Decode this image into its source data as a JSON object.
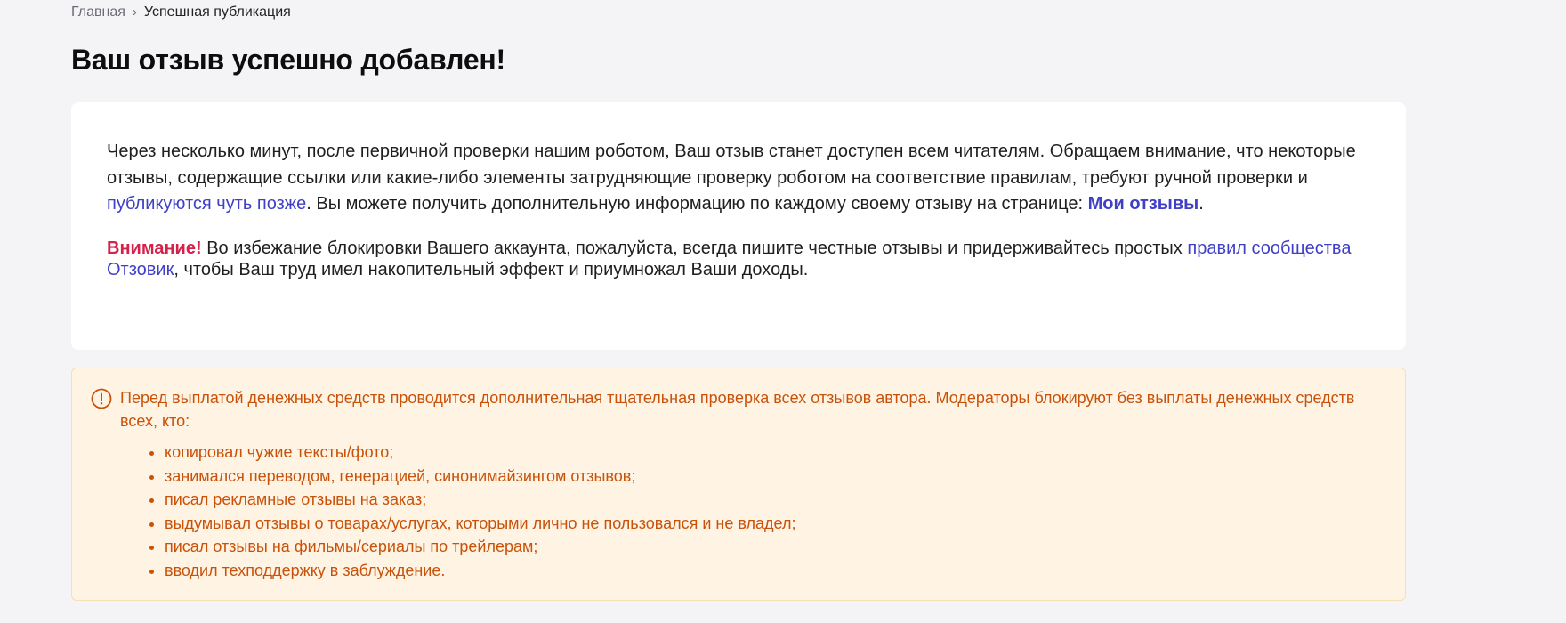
{
  "breadcrumb": {
    "home": "Главная",
    "separator": "›",
    "current": "Успешная публикация"
  },
  "title": "Ваш отзыв успешно добавлен!",
  "card": {
    "info": {
      "text_1": "Через несколько минут, после первичной проверки нашим роботом, Ваш отзыв станет доступен всем читателям. Обращаем внимание, что некоторые отзывы, содержащие ссылки или какие-либо элементы затрудняющие проверку роботом на соответствие правилам, требуют ручной проверки и ",
      "link_later": "публикуются чуть позже",
      "text_2": ". Вы можете получить дополнительную информацию по каждому своему отзыву на странице: ",
      "link_my_reviews": "Мои отзывы",
      "text_3": "."
    },
    "warning": {
      "label": "Внимание!",
      "text_1": " Во избежание блокировки Вашего аккаунта, пожалуйста, всегда пишите честные отзывы и придерживайтесь простых ",
      "link_rules": "правил сообщества Отзовик",
      "text_2": ", чтобы Ваш труд имел накопительный эффект и приумножал Ваши доходы."
    }
  },
  "notice": {
    "icon": "exclamation-circle-icon",
    "lead": "Перед выплатой денежных средств проводится дополнительная тщательная проверка всех отзывов автора. Модераторы блокируют без выплаты денежных средств всех, кто:",
    "items": [
      "копировал чужие тексты/фото;",
      "занимался переводом, генерацией, синонимайзингом отзывов;",
      "писал рекламные отзывы на заказ;",
      "выдумывал отзывы о товарах/услугах, которыми лично не пользовался и не владел;",
      "писал отзывы на фильмы/сериалы по трейлерам;",
      "вводил техподдержку в заблуждение."
    ]
  },
  "colors": {
    "background": "#f4f4f6",
    "link": "#3f3fc7",
    "attention": "#d6214a",
    "notice_text": "#c8520a",
    "notice_bg": "#fff4e3"
  }
}
